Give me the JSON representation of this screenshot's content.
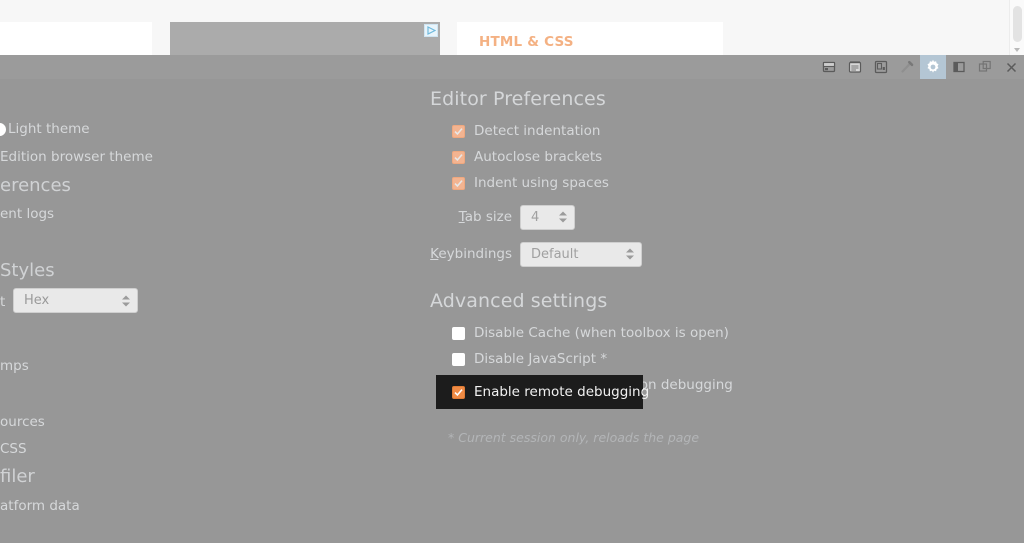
{
  "page": {
    "cards": [
      {
        "name": "left-card",
        "label": ""
      },
      {
        "name": "ad-placeholder-card",
        "label": ""
      },
      {
        "name": "html-css-card",
        "label": "HTML & CSS"
      }
    ],
    "adchoices_icon": "adchoices-icon",
    "scrollbar": "vertical-scrollbar"
  },
  "toolbar": {
    "icons": [
      {
        "name": "storage-icon",
        "title": "Storage"
      },
      {
        "name": "console-icon",
        "title": "Console"
      },
      {
        "name": "responsive-design-icon",
        "title": "Responsive Design Mode"
      },
      {
        "name": "eyedropper-icon",
        "title": "Eyedropper"
      },
      {
        "name": "settings-gear-icon",
        "title": "Settings",
        "active": true
      },
      {
        "name": "dock-side-icon",
        "title": "Dock to side"
      },
      {
        "name": "dock-separate-window-icon",
        "title": "Separate window"
      },
      {
        "name": "close-icon",
        "title": "Close"
      }
    ]
  },
  "left_column": {
    "theme_option": "Light theme",
    "theme_option_2": "Edition browser theme",
    "heading_preferences": "erences",
    "item_logs": "ent logs",
    "heading_styles": "Styles",
    "color_unit_label": "t",
    "color_unit_value": "Hex",
    "item_maps": "mps",
    "item_sources": "ources",
    "item_css": "CSS",
    "heading_profiler": "filer",
    "item_platform_data": "atform data"
  },
  "editor_preferences": {
    "title": "Editor Preferences",
    "checkboxes": [
      {
        "label": "Detect indentation",
        "checked": true
      },
      {
        "label": "Autoclose brackets",
        "checked": true
      },
      {
        "label": "Indent using spaces",
        "checked": true
      }
    ],
    "tab_size": {
      "label_prefix": "T",
      "label_rest": "ab size",
      "value": "4"
    },
    "keybindings": {
      "label_prefix": "K",
      "label_rest": "eybindings",
      "value": "Default"
    }
  },
  "advanced_settings": {
    "title": "Advanced settings",
    "checkboxes": [
      {
        "label": "Disable Cache (when toolbox is open)",
        "checked": false
      },
      {
        "label": "Disable JavaScript *",
        "checked": false
      },
      {
        "label": "Enable chrome and add-on debugging",
        "checked": true
      },
      {
        "label": "Enable remote debugging",
        "checked": true,
        "highlighted": true
      }
    ],
    "footnote": "* Current session only, reloads the page"
  },
  "colors": {
    "panel_background": "#979797",
    "toolbar_background": "#9b9b9b",
    "checkbox_accent": "#f3b491",
    "checkbox_accent_hot": "#f08b45",
    "highlight_background": "#1c1c1c",
    "text": "#d6d8da",
    "brand_orange": "#f4b183"
  }
}
